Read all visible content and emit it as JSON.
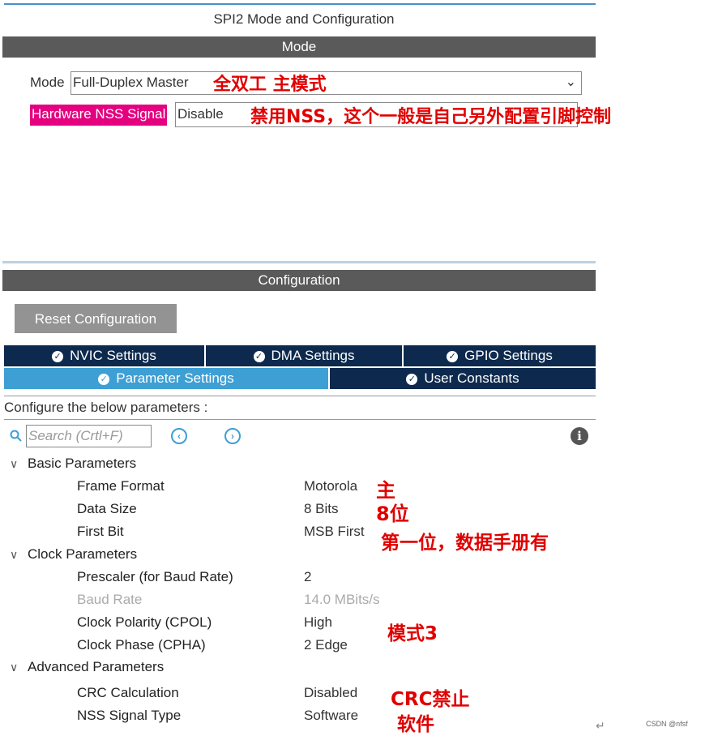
{
  "panel": {
    "title": "SPI2 Mode and Configuration",
    "mode_section": "Mode",
    "config_section": "Configuration"
  },
  "mode": {
    "label": "Mode",
    "value": "Full-Duplex Master",
    "annotation": "全双工 主模式"
  },
  "nss": {
    "label": "Hardware NSS Signal",
    "value": "Disable",
    "annotation": "禁用NSS，这个一般是自己另外配置引脚控制"
  },
  "reset_button": "Reset Configuration",
  "tabs": {
    "nvic": "NVIC Settings",
    "dma": "DMA Settings",
    "gpio": "GPIO Settings",
    "parameter": "Parameter Settings",
    "user_constants": "User Constants"
  },
  "configure_text": "Configure the below parameters :",
  "search": {
    "placeholder": "Search (Crtl+F)"
  },
  "groups": {
    "basic": {
      "label": "Basic Parameters",
      "params": [
        {
          "name": "Frame Format",
          "value": "Motorola",
          "note": "主"
        },
        {
          "name": "Data Size",
          "value": "8 Bits",
          "note": "8位"
        },
        {
          "name": "First Bit",
          "value": "MSB First",
          "note": "第一位，数据手册有"
        }
      ]
    },
    "clock": {
      "label": "Clock Parameters",
      "params": [
        {
          "name": "Prescaler (for Baud Rate)",
          "value": "2"
        },
        {
          "name": "Baud Rate",
          "value": "14.0 MBits/s"
        },
        {
          "name": "Clock Polarity (CPOL)",
          "value": "High"
        },
        {
          "name": "Clock Phase (CPHA)",
          "value": "2 Edge"
        }
      ],
      "note": "模式3"
    },
    "advanced": {
      "label": "Advanced Parameters",
      "params": [
        {
          "name": "CRC Calculation",
          "value": "Disabled",
          "note": "CRC禁止"
        },
        {
          "name": "NSS Signal Type",
          "value": "Software",
          "note": "软件"
        }
      ]
    }
  },
  "watermark": "CSDN @nfsf"
}
